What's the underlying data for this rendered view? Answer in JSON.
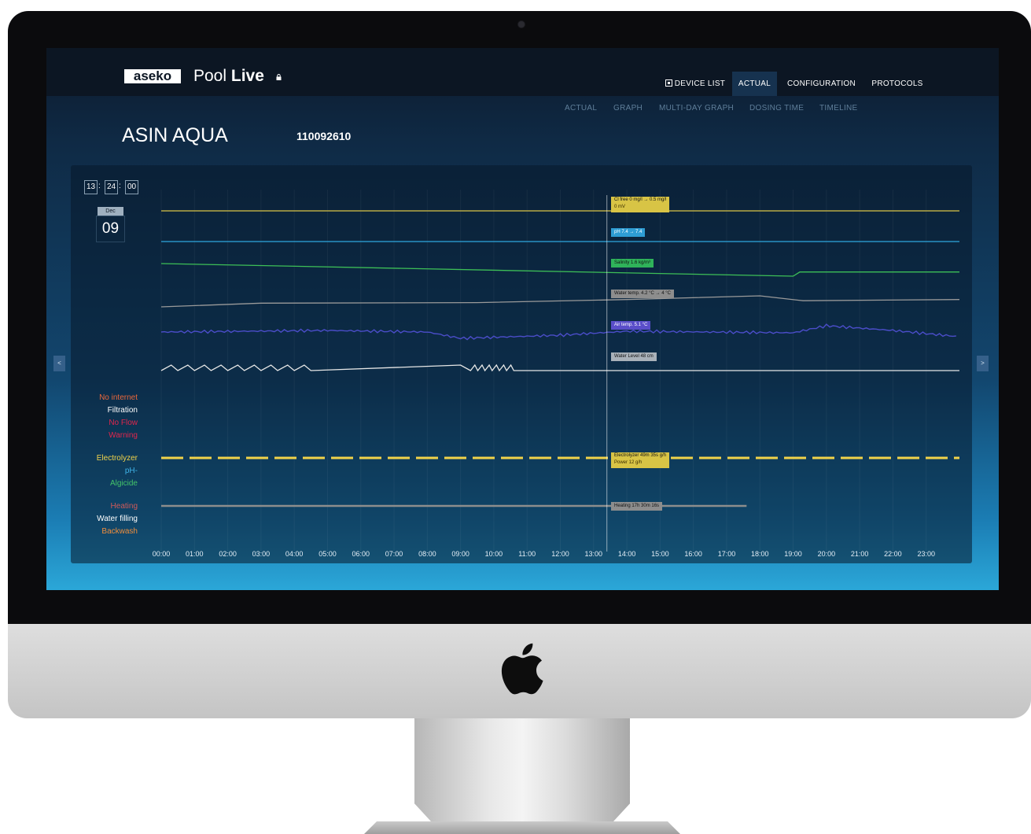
{
  "app": {
    "brand": "aseko",
    "title_light": "Pool ",
    "title_bold": "Live"
  },
  "nav": {
    "tabs": [
      {
        "label": "DEVICE LIST",
        "active": false
      },
      {
        "label": "ACTUAL",
        "active": true
      },
      {
        "label": "CONFIGURATION",
        "active": false
      },
      {
        "label": "PROTOCOLS",
        "active": false
      }
    ]
  },
  "subnav": {
    "tabs": [
      "ACTUAL",
      "GRAPH",
      "MULTI-DAY GRAPH",
      "DOSING TIME",
      "TIMELINE"
    ]
  },
  "device": {
    "name": "ASIN AQUA",
    "id": "110092610"
  },
  "clock": {
    "hh": "13",
    "mm": "24",
    "ss": "00",
    "sep": ":"
  },
  "date": {
    "month": "Dec",
    "day": "09"
  },
  "nav_arrows": {
    "prev": "<",
    "next": ">"
  },
  "status_labels": {
    "group1": [
      {
        "label": "No internet",
        "color": "#e9673b"
      },
      {
        "label": "Filtration",
        "color": "#ffffff"
      },
      {
        "label": "No Flow",
        "color": "#e0264d"
      },
      {
        "label": "Warning",
        "color": "#e0264d"
      }
    ],
    "group2": [
      {
        "label": "Electrolyzer",
        "color": "#f1d34a"
      },
      {
        "label": "pH-",
        "color": "#3fb3e8"
      },
      {
        "label": "Algicide",
        "color": "#44c46a"
      }
    ],
    "group3": [
      {
        "label": "Heating",
        "color": "#cf5a5a"
      },
      {
        "label": "Water filling",
        "color": "#ffffff"
      },
      {
        "label": "Backwash",
        "color": "#f08d3c"
      }
    ]
  },
  "tooltips": {
    "cl": {
      "line1": "Cl free 0 mg/l  →  0.5 mg/l",
      "line2": "0 mV",
      "color": "#d8c445"
    },
    "ph": {
      "text": "pH 7.4  →  7.4",
      "color": "#2e9dd4"
    },
    "salinity": {
      "text": "Salinity 1.6 kg/m³",
      "color": "#2fb35a"
    },
    "water_temp": {
      "text": "Water temp. 4.2 °C  →  4 °C",
      "color": "#8d8d8d"
    },
    "air_temp": {
      "text": "Air temp. 5.1 °C",
      "color": "#5a4ec9"
    },
    "water_level": {
      "text": "Water Level 48 cm",
      "color": "#a9b1b9"
    },
    "electrolyzer": {
      "line1": "Electrolyzer 49m 35s g/h",
      "line2": "Power 12 g/h",
      "color": "#d8c445"
    },
    "heating": {
      "text": "Heating 17h 30m 16s",
      "color": "#8d8d8d"
    }
  },
  "chart_data": {
    "type": "line",
    "x_labels": [
      "00:00",
      "01:00",
      "02:00",
      "03:00",
      "04:00",
      "05:00",
      "06:00",
      "07:00",
      "08:00",
      "09:00",
      "10:00",
      "11:00",
      "12:00",
      "13:00",
      "14:00",
      "15:00",
      "16:00",
      "17:00",
      "18:00",
      "19:00",
      "20:00",
      "21:00",
      "22:00",
      "23:00"
    ],
    "cursor_time": "13:24",
    "grid": true,
    "series": [
      {
        "key": "cl",
        "color": "#d9c447",
        "x": [
          0,
          24
        ],
        "y": [
          0,
          0
        ]
      },
      {
        "key": "ph",
        "color": "#2fa7df",
        "x": [
          0,
          24
        ],
        "y": [
          7.4,
          7.4
        ]
      },
      {
        "key": "salinity",
        "color": "#3dbf57",
        "x": [
          0,
          19,
          19.2,
          24
        ],
        "y": [
          1.7,
          1.55,
          1.6,
          1.6
        ]
      },
      {
        "key": "water_temp",
        "color": "#9a9a9a",
        "x": [
          0,
          3,
          9.5,
          14,
          18,
          19.3,
          24
        ],
        "y": [
          3.6,
          3.9,
          3.95,
          4.2,
          4.5,
          4.1,
          4.2
        ]
      },
      {
        "key": "air_temp",
        "color": "#4b4dc9",
        "x": [
          0,
          5,
          8,
          9,
          12,
          14,
          19,
          20,
          22,
          24
        ],
        "y": [
          5.0,
          5.2,
          5.0,
          4.2,
          4.6,
          5.1,
          4.9,
          5.8,
          5.2,
          4.4
        ]
      },
      {
        "key": "water_level",
        "color": "#e6e6e6",
        "x": [
          0,
          24
        ],
        "y": [
          48,
          48
        ]
      }
    ],
    "bars": [
      {
        "key": "electrolyzer",
        "color": "#f1d34a",
        "dashed": true,
        "start": 0,
        "end": 24
      },
      {
        "key": "heating",
        "color": "#8d8d8d",
        "dashed": false,
        "start": 0,
        "end": 17.6
      }
    ]
  }
}
